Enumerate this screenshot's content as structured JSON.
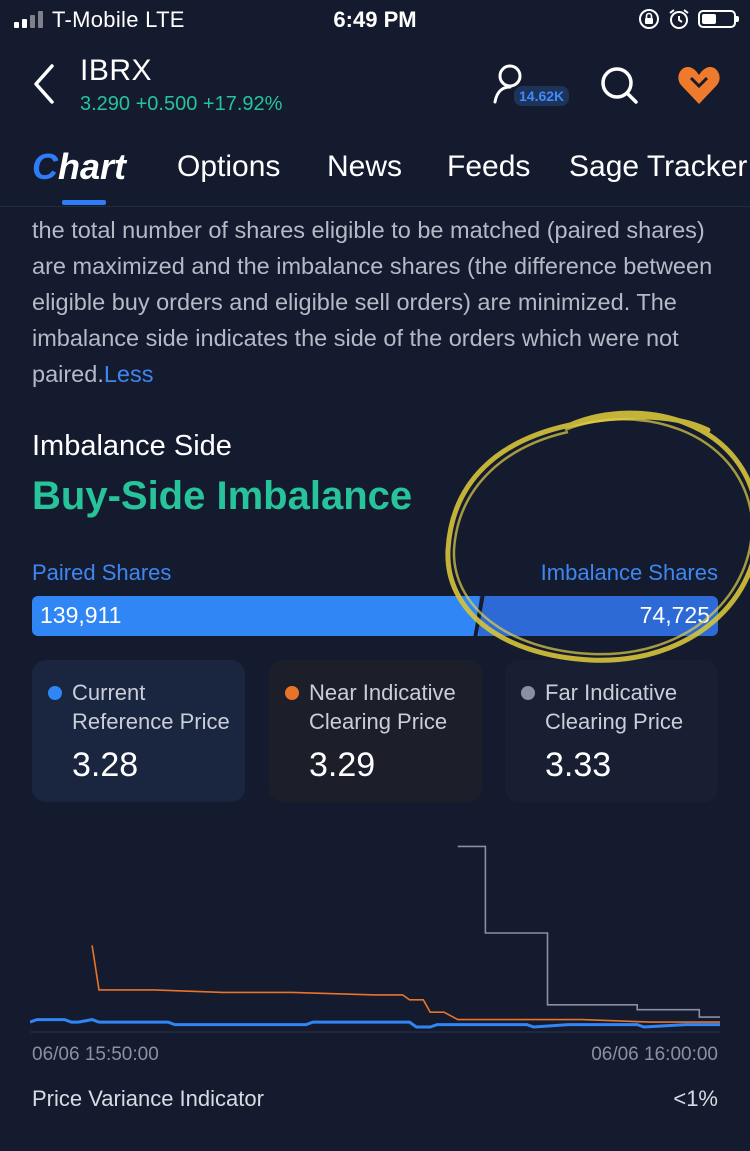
{
  "status_bar": {
    "carrier": "T-Mobile  LTE",
    "time": "6:49 PM"
  },
  "header": {
    "ticker": "IBRX",
    "quote": "3.290 +0.500 +17.92%",
    "followers": "14.62K"
  },
  "tabs": [
    {
      "label": "Chart",
      "active": true
    },
    {
      "label": "Options"
    },
    {
      "label": "News"
    },
    {
      "label": "Feeds"
    },
    {
      "label": "Sage Tracker"
    }
  ],
  "description": {
    "text": "the total number of shares eligible to be matched (paired shares) are maximized and the imbalance shares (the difference between eligible buy orders and eligible sell orders) are minimized. The imbalance side indicates the side of the orders which were not paired.",
    "less_link": "Less"
  },
  "imbalance": {
    "side_label": "Imbalance Side",
    "side_value": "Buy-Side Imbalance",
    "paired_label": "Paired Shares",
    "imbalance_label": "Imbalance Shares",
    "paired_shares": "139,911",
    "imbalance_shares": "74,725",
    "paired_fraction": 0.6518
  },
  "cards": [
    {
      "label_1": "Current",
      "label_2": "Reference Price",
      "value": "3.28",
      "dot_color": "#2f86f4"
    },
    {
      "label_1": "Near Indicative",
      "label_2": "Clearing Price",
      "value": "3.29",
      "dot_color": "#e8732a"
    },
    {
      "label_1": "Far Indicative",
      "label_2": "Clearing Price",
      "value": "3.33",
      "dot_color": "#8a8fa3"
    }
  ],
  "chart": {
    "time_start": "06/06 15:50:00",
    "time_end": "06/06 16:00:00"
  },
  "chart_data": {
    "type": "line",
    "x_start": "06/06 15:50:00",
    "x_end": "06/06 16:00:00",
    "series": [
      {
        "color": "#8a8fa3",
        "x": [
          0.0,
          0.62,
          0.62,
          0.66,
          0.66,
          0.75,
          0.75,
          0.88,
          0.88,
          0.97,
          0.97,
          0.99,
          1.0
        ],
        "values": [
          null,
          null,
          4.0,
          4.0,
          3.65,
          3.65,
          3.36,
          3.36,
          3.34,
          3.34,
          3.31,
          3.31,
          3.31
        ]
      },
      {
        "color": "#e8732a",
        "x": [
          0.09,
          0.09,
          0.1,
          0.18,
          0.28,
          0.38,
          0.5,
          0.54,
          0.55,
          0.57,
          0.58,
          0.6,
          0.62,
          0.7,
          0.8,
          0.9,
          1.0
        ],
        "values": [
          3.6,
          3.6,
          3.42,
          3.42,
          3.41,
          3.41,
          3.4,
          3.4,
          3.38,
          3.38,
          3.33,
          3.33,
          3.3,
          3.3,
          3.3,
          3.29,
          3.29
        ]
      },
      {
        "color": "#2f86f4",
        "x": [
          0.0,
          0.01,
          0.05,
          0.06,
          0.07,
          0.09,
          0.1,
          0.2,
          0.21,
          0.3,
          0.4,
          0.41,
          0.55,
          0.56,
          0.58,
          0.59,
          0.72,
          0.73,
          0.78,
          0.8,
          0.88,
          0.89,
          0.95,
          1.0
        ],
        "values": [
          3.29,
          3.3,
          3.3,
          3.29,
          3.29,
          3.3,
          3.29,
          3.29,
          3.28,
          3.28,
          3.28,
          3.29,
          3.29,
          3.27,
          3.27,
          3.28,
          3.28,
          3.27,
          3.28,
          3.28,
          3.28,
          3.27,
          3.28,
          3.28
        ]
      }
    ],
    "ylim": [
      3.25,
      4.05
    ]
  },
  "pvi": {
    "label": "Price Variance Indicator",
    "value": "<1%"
  }
}
